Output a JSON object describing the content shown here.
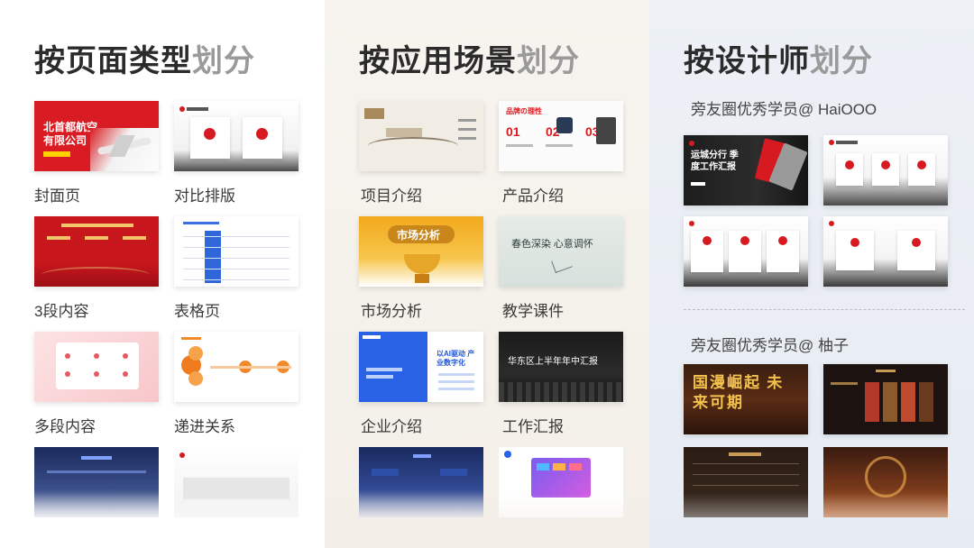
{
  "colors": {
    "heading_dark": "#2b2b2b",
    "heading_light": "#9a9a9a",
    "accent_red": "#d71a21"
  },
  "columns": [
    {
      "heading_main": "按页面类型",
      "heading_suffix": "划分",
      "items": [
        {
          "caption": "封面页",
          "thumb_text": "北首都航空有限公司"
        },
        {
          "caption": "对比排版",
          "thumb_text": ""
        },
        {
          "caption": "3段内容",
          "thumb_text": ""
        },
        {
          "caption": "表格页",
          "thumb_text": ""
        },
        {
          "caption": "多段内容",
          "thumb_text": ""
        },
        {
          "caption": "递进关系",
          "thumb_text": ""
        }
      ]
    },
    {
      "heading_main": "按应用场景",
      "heading_suffix": "划分",
      "items": [
        {
          "caption": "项目介绍",
          "thumb_text": ""
        },
        {
          "caption": "产品介绍",
          "thumb_text": "品牌の理性"
        },
        {
          "caption": "市场分析",
          "thumb_text": "市场分析"
        },
        {
          "caption": "教学课件",
          "thumb_text": "春色深染 心意调怀"
        },
        {
          "caption": "企业介绍",
          "thumb_text": "以AI驱动 产业数字化"
        },
        {
          "caption": "工作汇报",
          "thumb_text": "华东区上半年年中汇报"
        }
      ]
    },
    {
      "heading_main": "按设计师",
      "heading_suffix": "划分",
      "designers": [
        {
          "label": "旁友圈优秀学员@ HaiOOO",
          "thumb_text": "运城分行 季度工作汇报"
        },
        {
          "label": "旁友圈优秀学员@ 柚子",
          "thumb_text": "国漫崛起 未来可期"
        }
      ]
    }
  ]
}
